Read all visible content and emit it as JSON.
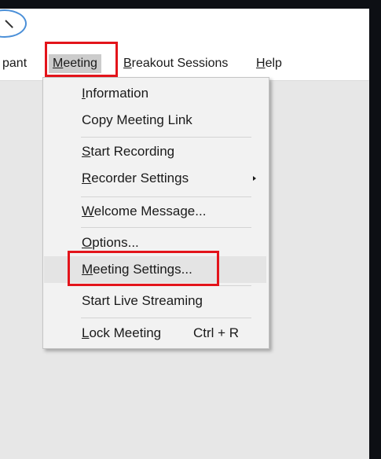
{
  "menubar": {
    "participant_label": "pant",
    "meeting_label": "Meeting",
    "breakout_label": "Breakout Sessions",
    "help_label": "Help"
  },
  "meeting_menu": {
    "items": [
      {
        "label": "Information"
      },
      {
        "label": "Copy Meeting Link"
      },
      {
        "label": "Start Recording"
      },
      {
        "label": "Recorder Settings",
        "has_submenu": true
      },
      {
        "label": "Welcome Message..."
      },
      {
        "label": "Options..."
      },
      {
        "label": "Meeting Settings...",
        "highlighted": true
      },
      {
        "label": "Start Live Streaming"
      },
      {
        "label": "Lock Meeting",
        "shortcut": "Ctrl + R"
      }
    ]
  },
  "colors": {
    "highlight_box": "#e3141b",
    "menu_background": "#f2f2f2",
    "active_menu": "#cccccc"
  },
  "icons": {
    "title_circle": "circle-icon"
  }
}
